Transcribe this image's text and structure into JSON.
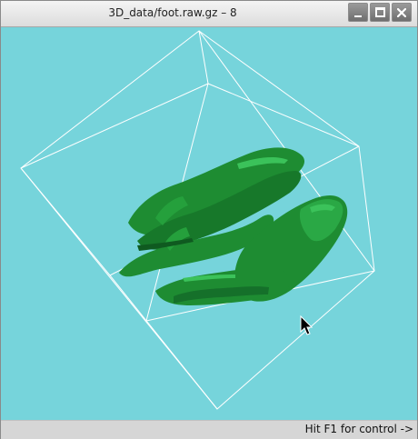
{
  "window": {
    "title": "3D_data/foot.raw.gz – 8"
  },
  "viewport": {
    "background_color": "#76d4db",
    "model_color": "#1e8c32",
    "bounding_box_color": "#ffffff",
    "content": "3D volume rendering of foot bones"
  },
  "status": {
    "hint": "Hit F1 for control ->"
  },
  "icons": {
    "minimize": "minimize-icon",
    "maximize": "maximize-icon",
    "close": "close-icon",
    "cursor": "mouse-pointer-icon"
  }
}
